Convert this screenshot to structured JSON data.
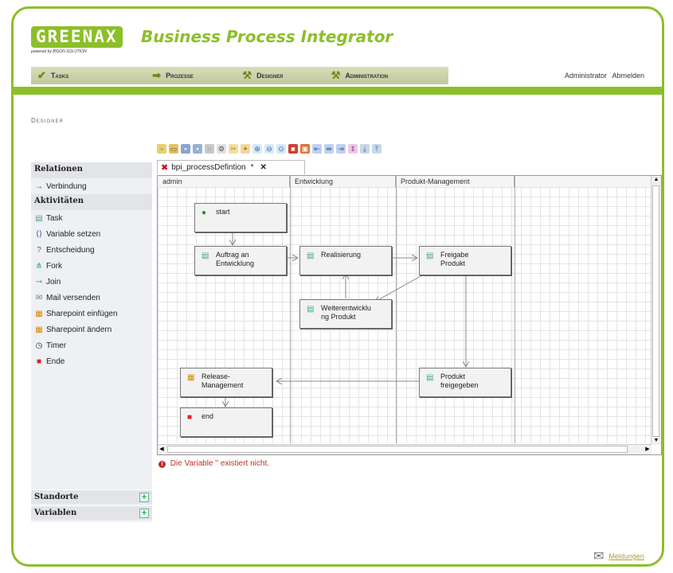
{
  "brand": {
    "logo": "GREENAX",
    "tagline": "powered by BISON SOLUTION",
    "app_title": "Business Process Integrator",
    "accent": "#8cbf2a"
  },
  "nav": [
    {
      "label": "Tasks",
      "icon": "check-icon"
    },
    {
      "label": "Prozesse",
      "icon": "arrow-icon"
    },
    {
      "label": "Designer",
      "icon": "tools-icon"
    },
    {
      "label": "Administration",
      "icon": "tools-icon"
    }
  ],
  "user": {
    "name": "Administrator",
    "logout": "Abmelden"
  },
  "page_title": "Designer",
  "palette": {
    "relations_header": "Relationen",
    "relations": [
      {
        "label": "Verbindung",
        "icon": "arrow-right-icon"
      }
    ],
    "activities_header": "Aktivitäten",
    "activities": [
      {
        "label": "Task",
        "icon": "task-icon"
      },
      {
        "label": "Variable setzen",
        "icon": "variable-icon"
      },
      {
        "label": "Entscheidung",
        "icon": "decision-icon"
      },
      {
        "label": "Fork",
        "icon": "fork-icon"
      },
      {
        "label": "Join",
        "icon": "join-icon"
      },
      {
        "label": "Mail versenden",
        "icon": "mail-icon"
      },
      {
        "label": "Sharepoint einfügen",
        "icon": "sharepoint-icon"
      },
      {
        "label": "Sharepoint ändern",
        "icon": "sharepoint-icon"
      },
      {
        "label": "Timer",
        "icon": "timer-icon"
      },
      {
        "label": "Ende",
        "icon": "end-icon"
      }
    ],
    "locations_header": "Standorte",
    "variables_header": "Variablen"
  },
  "tab": {
    "label": "bpi_processDefintion",
    "modified_marker": "*"
  },
  "lanes": [
    "admin",
    "Entwicklung",
    "Produkt-Management"
  ],
  "nodes": [
    {
      "id": "start",
      "label": "start",
      "icon": "start-icon"
    },
    {
      "id": "auftrag",
      "label": "Auftrag an\nEntwicklung",
      "icon": "task-icon"
    },
    {
      "id": "real",
      "label": "Realisierung",
      "icon": "task-icon"
    },
    {
      "id": "freigabe",
      "label": "Freigabe\nProdukt",
      "icon": "task-icon"
    },
    {
      "id": "weiter",
      "label": "Weiterentwicklu\nng Produkt",
      "icon": "task-icon"
    },
    {
      "id": "release",
      "label": "Release-\nManagement",
      "icon": "sharepoint-icon"
    },
    {
      "id": "freigeg",
      "label": "Produkt\nfreigegeben",
      "icon": "task-icon"
    },
    {
      "id": "end",
      "label": "end",
      "icon": "end-icon"
    }
  ],
  "error": {
    "text": "Die Variable '' existiert nicht."
  },
  "messages": {
    "label": "Meldungen"
  },
  "colors": {
    "error": "#c0302a",
    "nav_bg": "#d9dcb8",
    "palette_bg": "#eef0f3"
  }
}
